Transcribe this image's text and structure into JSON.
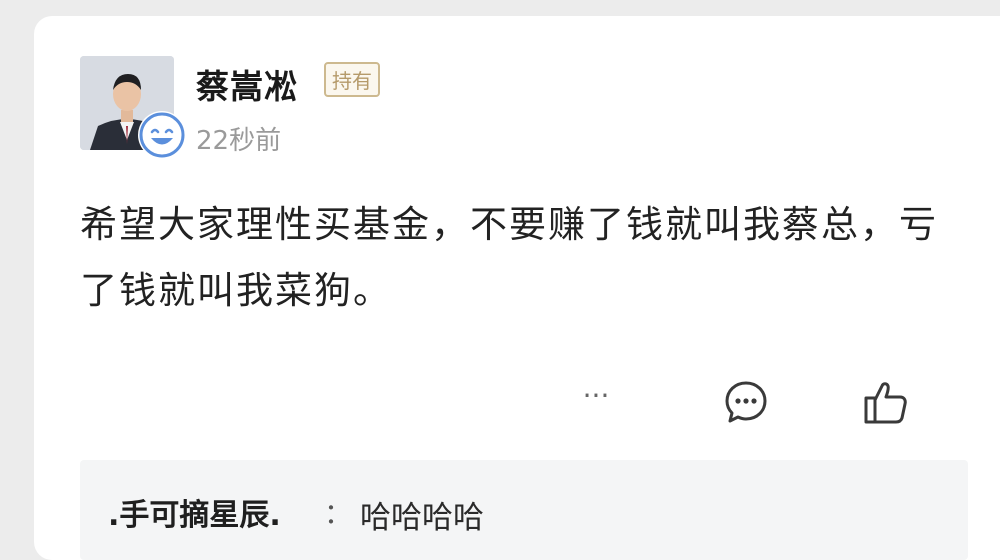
{
  "post": {
    "author": "蔡嵩凇",
    "tag": "持有",
    "time": "22秒前",
    "text": "希望大家理性买基金，不要赚了钱就叫我蔡总，亏了钱就叫我菜狗。"
  },
  "actions": {
    "more": "···",
    "comment_icon": "comment-bubble-icon",
    "like_icon": "thumbs-up-icon"
  },
  "reply": {
    "author": ".手可摘星辰.",
    "separator": "：",
    "text": "哈哈哈哈"
  },
  "colors": {
    "tag_border": "#cdb98f",
    "tag_text": "#b59a6a",
    "badge_blue": "#5b8fdc"
  }
}
